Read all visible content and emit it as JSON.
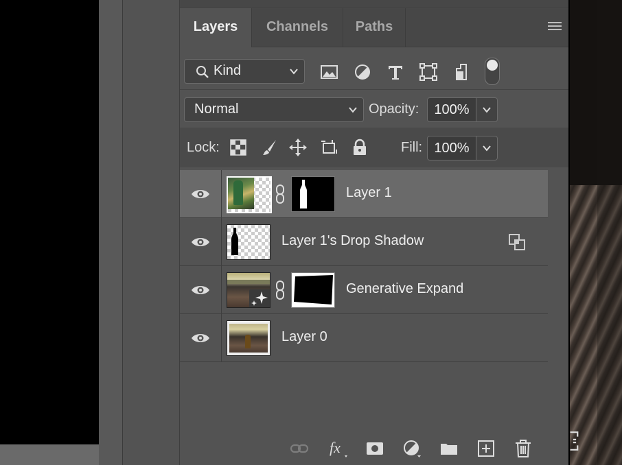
{
  "tabs": [
    {
      "label": "Layers",
      "active": true
    },
    {
      "label": "Channels",
      "active": false
    },
    {
      "label": "Paths",
      "active": false
    }
  ],
  "filter": {
    "kind_label": "Kind",
    "filter_icons": [
      "image-filter-icon",
      "adjustment-filter-icon",
      "type-filter-icon",
      "shape-filter-icon",
      "smart-object-filter-icon",
      "filter-toggle-icon"
    ]
  },
  "blend": {
    "mode": "Normal",
    "opacity_label": "Opacity:",
    "opacity_value": "100%"
  },
  "lock": {
    "label": "Lock:",
    "icons": [
      "lock-transparent-pixels-icon",
      "lock-image-pixels-icon",
      "lock-position-icon",
      "lock-artboard-icon",
      "lock-all-icon"
    ],
    "fill_label": "Fill:",
    "fill_value": "100%"
  },
  "layers": [
    {
      "name": "Layer 1",
      "selected": true,
      "has_mask": true
    },
    {
      "name": "Layer 1's Drop Shadow",
      "selected": false,
      "has_mask": false
    },
    {
      "name": "Generative Expand",
      "selected": false,
      "has_mask": true
    },
    {
      "name": "Layer 0",
      "selected": false,
      "has_mask": false
    }
  ],
  "bottom_icons": [
    "link-layers-icon",
    "fx-icon",
    "add-mask-icon",
    "adjustment-layer-icon",
    "new-group-icon",
    "new-layer-icon",
    "delete-icon"
  ],
  "colors": {
    "panel_bg": "#535353",
    "selected_row": "#6a6a6a",
    "tab_bar": "#474747"
  }
}
